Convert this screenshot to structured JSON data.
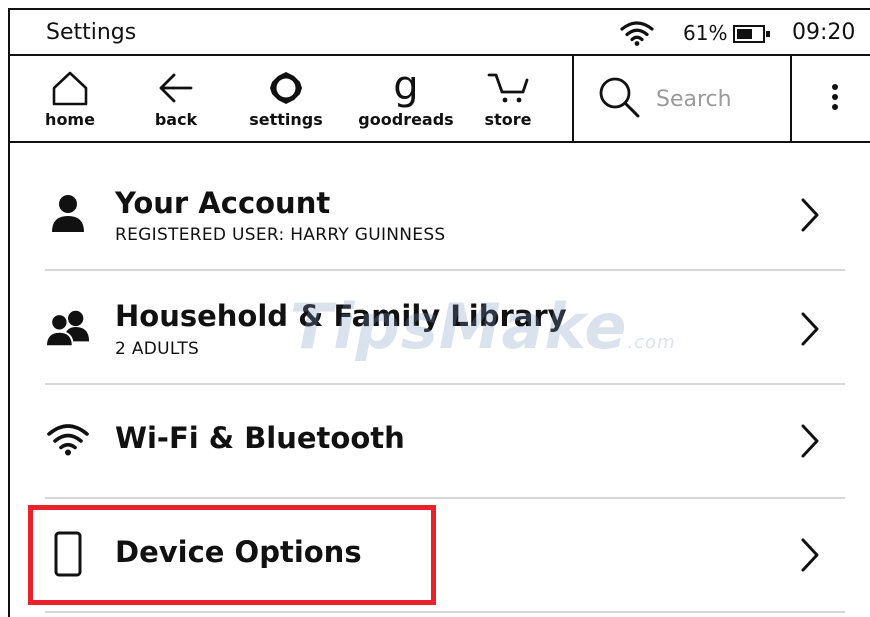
{
  "status_bar": {
    "title": "Settings",
    "battery_percent": "61%",
    "battery_level": 0.61,
    "time": "09:20"
  },
  "toolbar": {
    "home_label": "home",
    "back_label": "back",
    "settings_label": "settings",
    "goodreads_glyph": "g",
    "goodreads_label": "goodreads",
    "store_label": "store",
    "search_placeholder": "Search"
  },
  "settings_list": [
    {
      "title": "Your Account",
      "subtitle": "REGISTERED USER: HARRY GUINNESS",
      "icon": "person-icon"
    },
    {
      "title": "Household & Family Library",
      "subtitle": "2 ADULTS",
      "icon": "people-icon"
    },
    {
      "title": "Wi-Fi & Bluetooth",
      "subtitle": "",
      "icon": "wifi-icon"
    },
    {
      "title": "Device Options",
      "subtitle": "",
      "icon": "device-icon"
    }
  ],
  "highlight_color": "#e8212a",
  "watermark": {
    "text": "TipsMake",
    "suffix": ".com"
  }
}
